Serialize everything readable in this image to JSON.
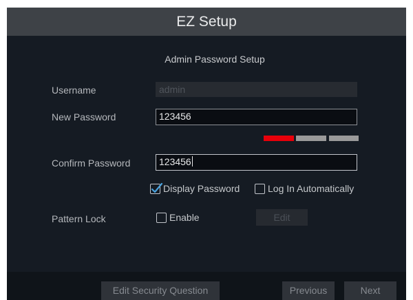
{
  "dialog": {
    "title": "EZ Setup",
    "subtitle": "Admin Password Setup"
  },
  "form": {
    "username_label": "Username",
    "username_value": "admin",
    "new_password_label": "New Password",
    "new_password_value": "123456",
    "password_strength": {
      "filled_segments": 1,
      "total_segments": 3,
      "color": "#e8000a"
    },
    "confirm_password_label": "Confirm Password",
    "confirm_password_value": "123456",
    "display_password_label": "Display Password",
    "display_password_checked": true,
    "log_in_automatically_label": "Log In Automatically",
    "log_in_automatically_checked": false,
    "pattern_lock_label": "Pattern Lock",
    "pattern_lock_enable_label": "Enable",
    "pattern_lock_enabled": false,
    "pattern_lock_edit_label": "Edit"
  },
  "footer": {
    "edit_security_question_label": "Edit Security Question",
    "previous_label": "Previous",
    "next_label": "Next"
  },
  "colors": {
    "accent_check": "#4aa3df",
    "strength_weak": "#e8000a",
    "strength_empty": "#9a9a9a"
  }
}
